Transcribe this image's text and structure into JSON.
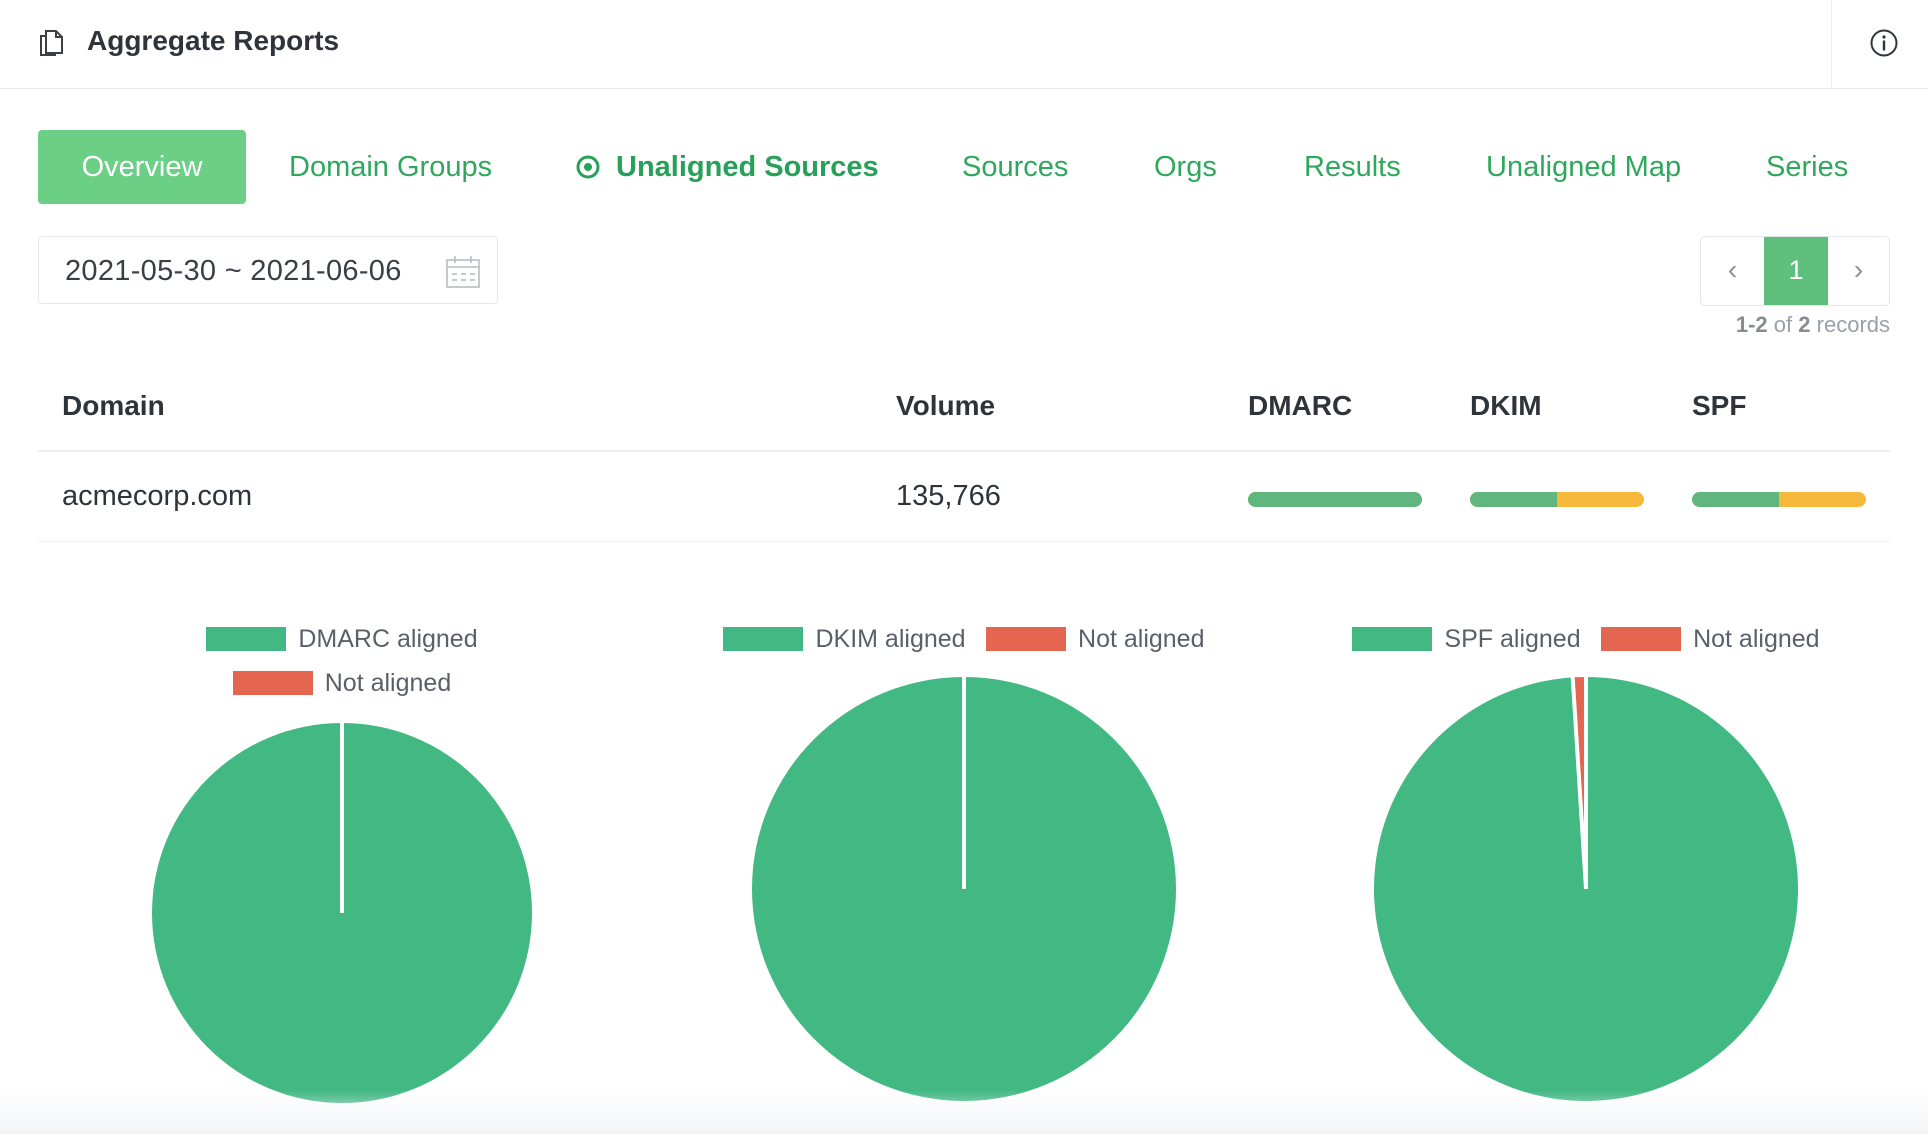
{
  "header": {
    "title": "Aggregate Reports",
    "title_icon": "document-copy-icon",
    "info_icon": "info-circle-icon"
  },
  "tabs": [
    {
      "label": "Overview",
      "state": "active"
    },
    {
      "label": "Domain Groups"
    },
    {
      "label": "Unaligned Sources",
      "state": "current",
      "icon": "radio-dot-icon"
    },
    {
      "label": "Sources"
    },
    {
      "label": "Orgs"
    },
    {
      "label": "Results"
    },
    {
      "label": "Unaligned Map"
    },
    {
      "label": "Series"
    }
  ],
  "date_range": {
    "value": "2021-05-30 ~ 2021-06-06",
    "icon": "calendar-icon"
  },
  "pagination": {
    "prev": "‹",
    "current_page": "1",
    "next": "›",
    "range": "1-2",
    "of": "of",
    "total": "2",
    "records": "records"
  },
  "table": {
    "headers": {
      "domain": "Domain",
      "volume": "Volume",
      "dmarc": "DMARC",
      "dkim": "DKIM",
      "spf": "SPF"
    },
    "rows": [
      {
        "domain": "acmecorp.com",
        "volume": "135,766",
        "dmarc_aligned_fraction": 1.0,
        "dkim_aligned_fraction": 0.5,
        "spf_aligned_fraction": 0.5
      }
    ]
  },
  "colors": {
    "accent": "#2fa85d",
    "tab_active_bg": "#6ccf86",
    "aligned": "#42b883",
    "not_aligned": "#e46651",
    "bar_aligned": "#5fb67e",
    "bar_partial": "#f7b93b"
  },
  "chart_data": [
    {
      "type": "pie",
      "legend": [
        "DMARC aligned",
        "Not aligned"
      ],
      "values": [
        100,
        0
      ]
    },
    {
      "type": "pie",
      "legend": [
        "DKIM aligned",
        "Not aligned"
      ],
      "values": [
        100,
        0
      ]
    },
    {
      "type": "pie",
      "legend": [
        "SPF aligned",
        "Not aligned"
      ],
      "values": [
        99,
        1
      ]
    }
  ]
}
